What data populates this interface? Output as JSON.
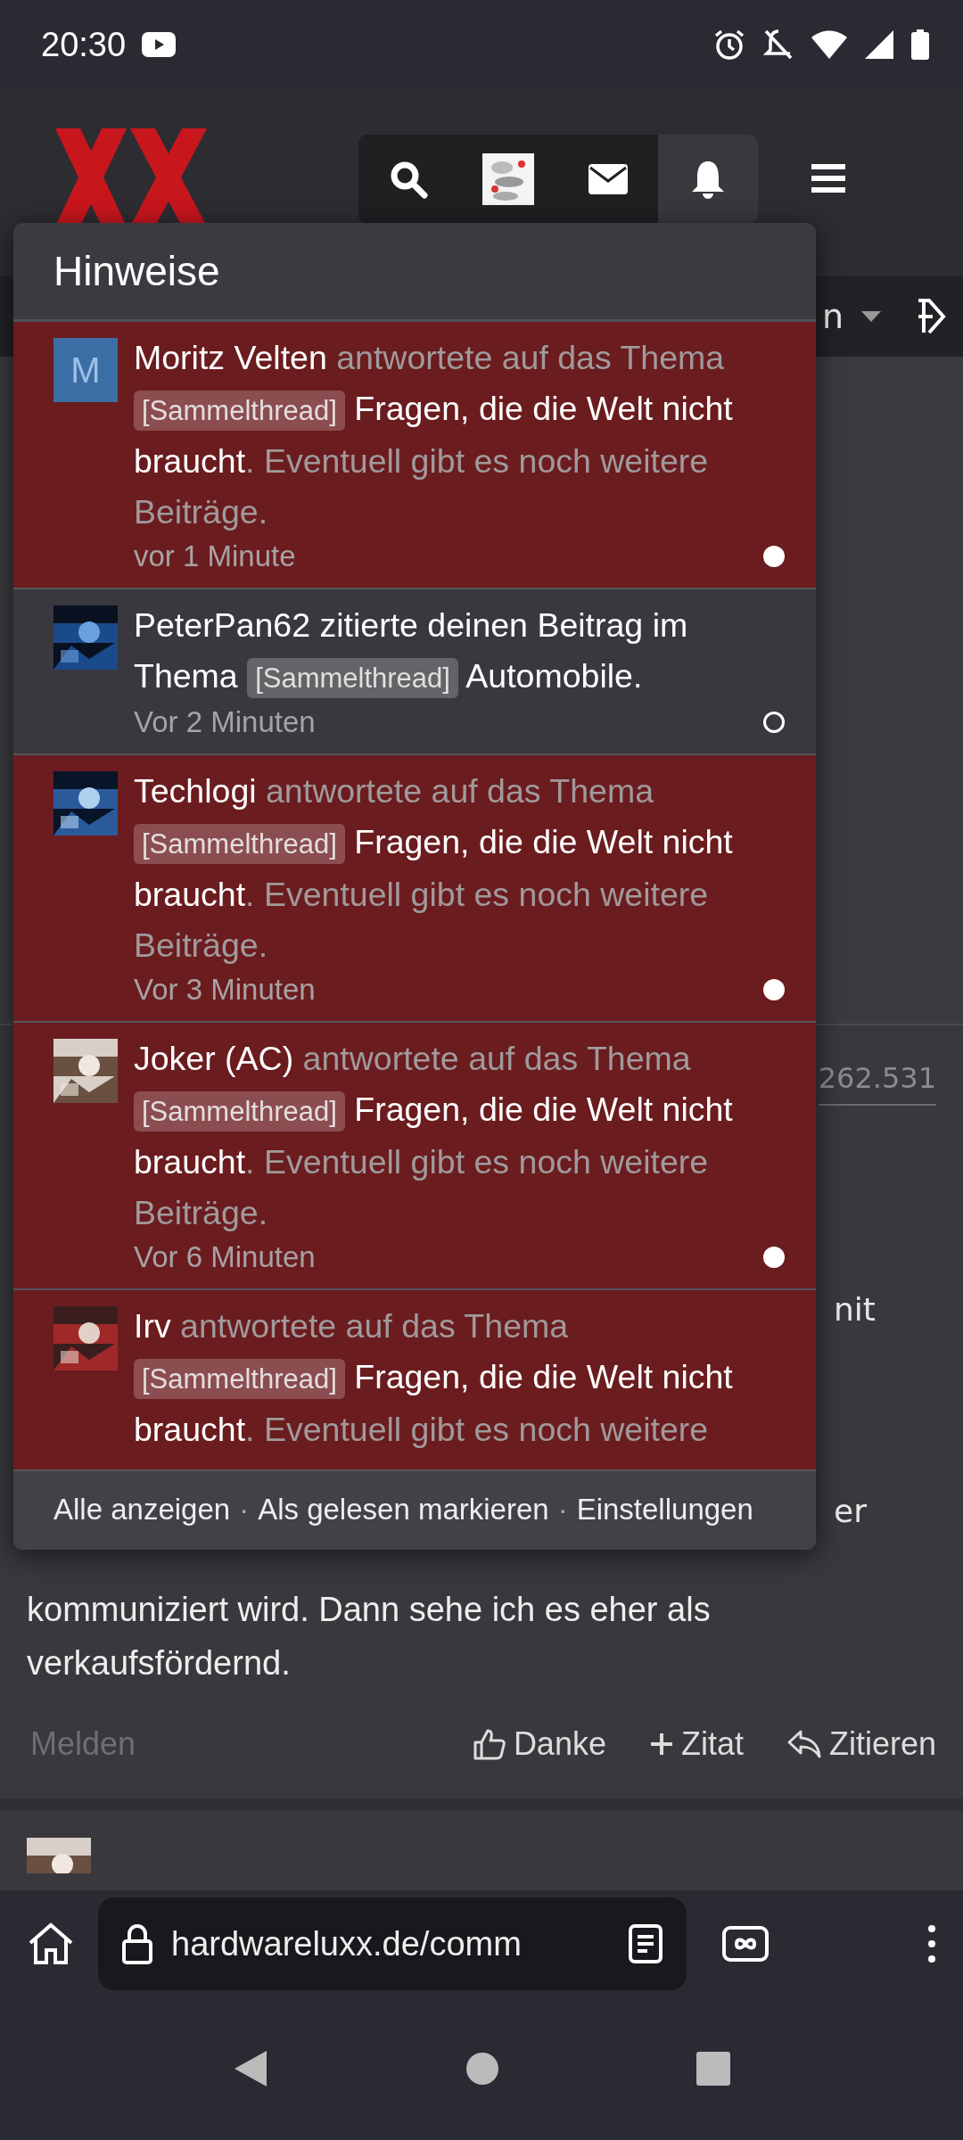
{
  "status_bar": {
    "time": "20:30"
  },
  "header": {
    "toolbar": [
      {
        "kind": "search",
        "selected": false
      },
      {
        "kind": "avatar",
        "selected": false
      },
      {
        "kind": "mail",
        "selected": false
      },
      {
        "kind": "bell",
        "selected": true
      }
    ]
  },
  "nav": {
    "label": "n"
  },
  "notifications": {
    "title": "Hinweise",
    "items": [
      {
        "kind": "reply",
        "avatar": {
          "kind": "letter",
          "letter": "M"
        },
        "name": "Moritz Velten",
        "action": "antwortete auf das Thema",
        "tag": "[Sammelthread]",
        "topic": "Fragen, die die Welt nicht braucht",
        "suffix": ". Eventuell gibt es noch weitere Beiträge.",
        "time": "vor 1 Minute",
        "unread": true
      },
      {
        "kind": "quote",
        "name": "PeterPan62",
        "action": "zitierte deinen Beitrag im Thema",
        "tag": "[Sammelthread]",
        "topic": "Automobile.",
        "time": "Vor 2 Minuten",
        "unread": false
      },
      {
        "kind": "reply",
        "name": "Techlogi",
        "action": "antwortete auf das Thema",
        "tag": "[Sammelthread]",
        "topic": "Fragen, die die Welt nicht braucht",
        "suffix": ". Eventuell gibt es noch weitere Beiträge.",
        "time": "Vor 3 Minuten",
        "unread": true
      },
      {
        "kind": "reply",
        "name": "Joker (AC)",
        "action": "antwortete auf das Thema",
        "tag": "[Sammelthread]",
        "topic": "Fragen, die die Welt nicht braucht",
        "suffix": ". Eventuell gibt es noch weitere Beiträge.",
        "time": "Vor 6 Minuten",
        "unread": true
      },
      {
        "kind": "reply",
        "name": "Irv",
        "action": "antwortete auf das Thema",
        "tag": "[Sammelthread]",
        "topic": "Fragen, die die Welt nicht braucht",
        "suffix": ". Eventuell gibt es noch weitere",
        "unread": true
      }
    ],
    "footer": {
      "links": [
        "Alle anzeigen",
        "Als gelesen markieren",
        "Einstellungen"
      ],
      "separator": "·"
    }
  },
  "post": {
    "number": "262.531",
    "fragments": [
      "nit",
      "er"
    ],
    "text": "kommuniziert wird. Dann sehe ich es eher als verkaufsfördernd.",
    "actions": [
      {
        "kind": "report",
        "label": "Melden"
      },
      {
        "kind": "like",
        "label": "Danke"
      },
      {
        "kind": "add-quote",
        "label": "Zitat"
      },
      {
        "kind": "reply",
        "label": "Zitieren"
      }
    ]
  },
  "browser": {
    "url": "hardwareluxx.de/comm"
  }
}
